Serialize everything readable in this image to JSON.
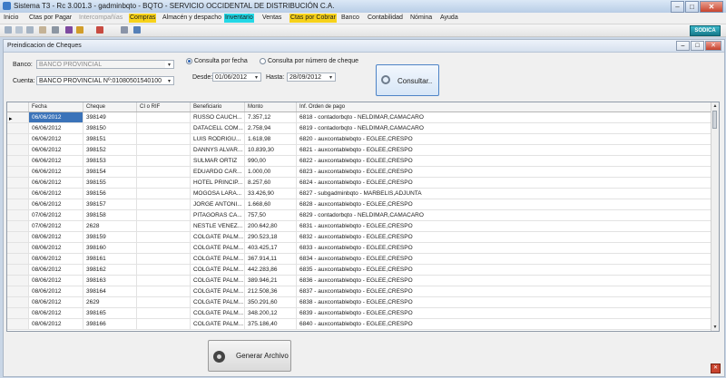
{
  "window": {
    "title": "Sistema T3 - Rc 3.001.3 - gadminbqto - BQTO - SERVICIO OCCIDENTAL DE DISTRIBUCIÓN C.A.",
    "minimize_glyph": "–",
    "maximize_glyph": "□",
    "close_glyph": "✕"
  },
  "menu": {
    "items": [
      {
        "label": "Inicio"
      },
      {
        "label": "Ctas por Pagar"
      },
      {
        "label": "Intercompañías"
      },
      {
        "label": "Compras"
      },
      {
        "label": "Almacén y despacho"
      },
      {
        "label": "Inventario"
      },
      {
        "label": "Ventas"
      },
      {
        "label": "Ctas por Cobrar"
      },
      {
        "label": "Banco"
      },
      {
        "label": "Contabilidad"
      },
      {
        "label": "Nómina"
      },
      {
        "label": "Ayuda"
      }
    ]
  },
  "toolbar": {
    "icons": [
      "new-icon",
      "open-icon",
      "save-icon",
      "delete-icon",
      "print-icon",
      "help-icon",
      "brush-icon",
      "print-preview-icon",
      "edit-icon"
    ]
  },
  "brand": {
    "label": "SODICA"
  },
  "panel": {
    "title": "Preindicacion de Cheques",
    "banco_label": "Banco:",
    "banco_value": "BANCO PROVINCIAL",
    "cuenta_label": "Cuenta:",
    "cuenta_value": "BANCO PROVINCIAL Nº:01080501540100",
    "radio_fecha": "Consulta por fecha",
    "radio_cheque": "Consulta por número de cheque",
    "desde_label": "Desde:",
    "desde_value": "01/06/2012",
    "hasta_label": "Hasta:",
    "hasta_value": "28/09/2012",
    "consultar_label": "Consultar..",
    "generar_label": "Generar Archivo"
  },
  "grid": {
    "columns": [
      "Fecha",
      "Cheque",
      "CI o RIF",
      "Beneficiario",
      "Monto",
      "Inf. Orden de pago"
    ],
    "rows": [
      {
        "fecha": "06/06/2012",
        "cheque": "398149",
        "rif": "",
        "beneficiario": "RUSSO CAUCH...",
        "monto": "7.357,12",
        "info": "6818 - contadorbqto - NELDIMAR,CAMACARO"
      },
      {
        "fecha": "06/06/2012",
        "cheque": "398150",
        "rif": "",
        "beneficiario": "DATACELL COM...",
        "monto": "2.758,94",
        "info": "6819 - contadorbqto - NELDIMAR,CAMACARO"
      },
      {
        "fecha": "06/06/2012",
        "cheque": "398151",
        "rif": "",
        "beneficiario": "LUIS RODRIGU...",
        "monto": "1.618,98",
        "info": "6820 - auxcontablebqto - EGLEE,CRESPO"
      },
      {
        "fecha": "06/06/2012",
        "cheque": "398152",
        "rif": "",
        "beneficiario": "DANNYS ALVAR...",
        "monto": "10.839,30",
        "info": "6821 - auxcontablebqto - EGLEE,CRESPO"
      },
      {
        "fecha": "06/06/2012",
        "cheque": "398153",
        "rif": "",
        "beneficiario": "SULMAR ORTIZ",
        "monto": "990,00",
        "info": "6822 - auxcontablebqto - EGLEE,CRESPO"
      },
      {
        "fecha": "06/06/2012",
        "cheque": "398154",
        "rif": "",
        "beneficiario": "EDUARDO CAR...",
        "monto": "1.000,00",
        "info": "6823 - auxcontablebqto - EGLEE,CRESPO"
      },
      {
        "fecha": "06/06/2012",
        "cheque": "398155",
        "rif": "",
        "beneficiario": "HOTEL PRINCIP...",
        "monto": "8.257,60",
        "info": "6824 - auxcontablebqto - EGLEE,CRESPO"
      },
      {
        "fecha": "06/06/2012",
        "cheque": "398156",
        "rif": "",
        "beneficiario": "MOGOSA LARA...",
        "monto": "33.426,90",
        "info": "6827 - subgadminbqto - MARBELIS,ADJUNTA"
      },
      {
        "fecha": "06/06/2012",
        "cheque": "398157",
        "rif": "",
        "beneficiario": "JORGE ANTONI...",
        "monto": "1.668,60",
        "info": "6828 - auxcontablebqto - EGLEE,CRESPO"
      },
      {
        "fecha": "07/06/2012",
        "cheque": "398158",
        "rif": "",
        "beneficiario": "PITAGORAS CA...",
        "monto": "757,50",
        "info": "6829 - contadorbqto - NELDIMAR,CAMACARO"
      },
      {
        "fecha": "07/06/2012",
        "cheque": "2628",
        "rif": "",
        "beneficiario": "NESTLE VENEZ...",
        "monto": "200.642,80",
        "info": "6831 - auxcontablebqto - EGLEE,CRESPO"
      },
      {
        "fecha": "08/06/2012",
        "cheque": "398159",
        "rif": "",
        "beneficiario": "COLGATE PALM...",
        "monto": "290.523,18",
        "info": "6832 - auxcontablebqto - EGLEE,CRESPO"
      },
      {
        "fecha": "08/06/2012",
        "cheque": "398160",
        "rif": "",
        "beneficiario": "COLGATE PALM...",
        "monto": "403.425,17",
        "info": "6833 - auxcontablebqto - EGLEE,CRESPO"
      },
      {
        "fecha": "08/06/2012",
        "cheque": "398161",
        "rif": "",
        "beneficiario": "COLGATE PALM...",
        "monto": "367.914,11",
        "info": "6834 - auxcontablebqto - EGLEE,CRESPO"
      },
      {
        "fecha": "08/06/2012",
        "cheque": "398162",
        "rif": "",
        "beneficiario": "COLGATE PALM...",
        "monto": "442.283,86",
        "info": "6835 - auxcontablebqto - EGLEE,CRESPO"
      },
      {
        "fecha": "08/06/2012",
        "cheque": "398163",
        "rif": "",
        "beneficiario": "COLGATE PALM...",
        "monto": "389.946,21",
        "info": "6836 - auxcontablebqto - EGLEE,CRESPO"
      },
      {
        "fecha": "08/06/2012",
        "cheque": "398164",
        "rif": "",
        "beneficiario": "COLGATE PALM...",
        "monto": "212.508,36",
        "info": "6837 - auxcontablebqto - EGLEE,CRESPO"
      },
      {
        "fecha": "08/06/2012",
        "cheque": "2629",
        "rif": "",
        "beneficiario": "COLGATE PALM...",
        "monto": "350.291,60",
        "info": "6838 - auxcontablebqto - EGLEE,CRESPO"
      },
      {
        "fecha": "08/06/2012",
        "cheque": "398165",
        "rif": "",
        "beneficiario": "COLGATE PALM...",
        "monto": "348.200,12",
        "info": "6839 - auxcontablebqto - EGLEE,CRESPO"
      },
      {
        "fecha": "08/06/2012",
        "cheque": "398166",
        "rif": "",
        "beneficiario": "COLGATE PALM...",
        "monto": "375.186,40",
        "info": "6840 - auxcontablebqto - EGLEE,CRESPO"
      }
    ]
  }
}
